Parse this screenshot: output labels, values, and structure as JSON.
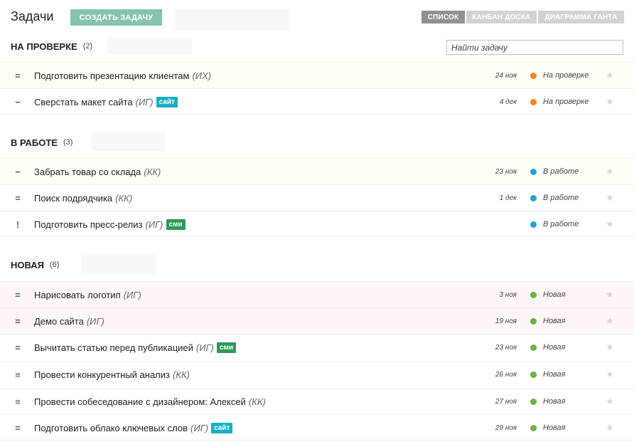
{
  "header": {
    "title": "Задачи",
    "create_label": "СОЗДАТЬ ЗАДАЧУ",
    "views": [
      "СПИСОК",
      "КАНБАН ДОСКА",
      "ДИАГРАММА ГАНТА"
    ],
    "search_placeholder": "Найти задачу"
  },
  "colors": {
    "review": "#f08a18",
    "in_progress": "#229fd9",
    "new": "#6ab33d",
    "tag_teal": "#17b0c3",
    "tag_green": "#2d9a5a"
  },
  "sections": [
    {
      "title": "НА ПРОВЕРКЕ",
      "count": "(2)",
      "tasks": [
        {
          "priority": "=",
          "title": "Подготовить презентацию клиентам",
          "owner": "(ИХ)",
          "tag": "",
          "date": "24 ноя",
          "status": "На проверке"
        },
        {
          "priority": "−",
          "title": "Сверстать макет сайта",
          "owner": "(ИГ)",
          "tag": "сайт",
          "date": "4 дек",
          "status": "На проверке"
        }
      ]
    },
    {
      "title": "В РАБОТЕ",
      "count": "(3)",
      "tasks": [
        {
          "priority": "−",
          "title": "Забрать товар со склада",
          "owner": "(КК)",
          "tag": "",
          "date": "23 ноя",
          "status": "В работе"
        },
        {
          "priority": "=",
          "title": "Поиск подрядчика",
          "owner": "(КК)",
          "tag": "",
          "date": "1 дек",
          "status": "В работе"
        },
        {
          "priority": "!",
          "title": "Подготовить пресс-релиз",
          "owner": "(ИГ)",
          "tag": "сми",
          "date": "",
          "status": "В работе"
        }
      ]
    },
    {
      "title": "НОВАЯ",
      "count": "(6)",
      "tasks": [
        {
          "priority": "=",
          "title": "Нарисовать логотип",
          "owner": "(ИГ)",
          "tag": "",
          "date": "3 ноя",
          "status": "Новая"
        },
        {
          "priority": "=",
          "title": "Демо сайта",
          "owner": "(ИГ)",
          "tag": "",
          "date": "19 ноя",
          "status": "Новая"
        },
        {
          "priority": "=",
          "title": "Вычитать статью перед публикацией",
          "owner": "(ИГ)",
          "tag": "сми",
          "date": "23 ноя",
          "status": "Новая"
        },
        {
          "priority": "≡",
          "title": "Провести конкурентный анализ",
          "owner": "(КК)",
          "tag": "",
          "date": "26 ноя",
          "status": "Новая"
        },
        {
          "priority": "≡",
          "title": "Провести собеседование с дизайнером: Алексей",
          "owner": "(КК)",
          "tag": "",
          "date": "27 ноя",
          "status": "Новая"
        },
        {
          "priority": "=",
          "title": "Подготовить облако ключевых слов",
          "owner": "(ИГ)",
          "tag": "сайт",
          "date": "29 ноя",
          "status": "Новая"
        }
      ]
    }
  ]
}
